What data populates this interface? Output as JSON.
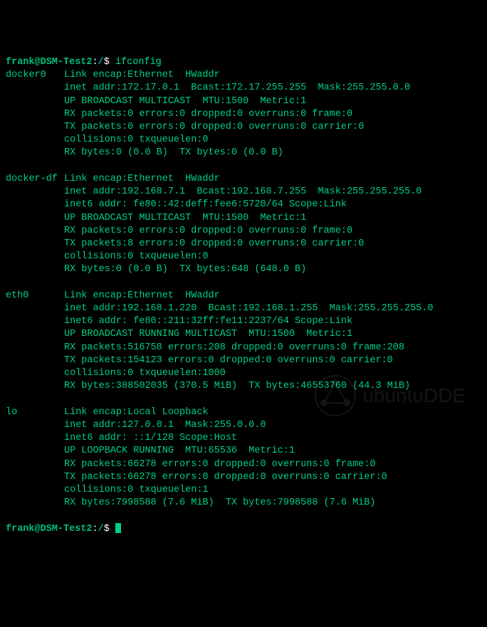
{
  "prompt": {
    "user": "frank@DSM-Test2",
    "path": "/",
    "symbol": "$"
  },
  "command": "ifconfig",
  "interfaces": [
    {
      "name": "docker0",
      "lines": [
        "Link encap:Ethernet  HWaddr ",
        "inet addr:172.17.0.1  Bcast:172.17.255.255  Mask:255.255.0.0",
        "UP BROADCAST MULTICAST  MTU:1500  Metric:1",
        "RX packets:0 errors:0 dropped:0 overruns:0 frame:0",
        "TX packets:0 errors:0 dropped:0 overruns:0 carrier:0",
        "collisions:0 txqueuelen:0",
        "RX bytes:0 (0.0 B)  TX bytes:0 (0.0 B)"
      ],
      "redact_first_line": true
    },
    {
      "name": "docker-df",
      "lines": [
        "Link encap:Ethernet  HWaddr ",
        "inet addr:192.168.7.1  Bcast:192.168.7.255  Mask:255.255.255.0",
        "inet6 addr: fe80::42:deff:fee6:5720/64 Scope:Link",
        "UP BROADCAST MULTICAST  MTU:1500  Metric:1",
        "RX packets:0 errors:0 dropped:0 overruns:0 frame:0",
        "TX packets:8 errors:0 dropped:0 overruns:0 carrier:0",
        "collisions:0 txqueuelen:0",
        "RX bytes:0 (0.0 B)  TX bytes:648 (648.0 B)"
      ],
      "redact_first_line": true
    },
    {
      "name": "eth0",
      "lines": [
        "Link encap:Ethernet  HWaddr ",
        "inet addr:192.168.1.220  Bcast:192.168.1.255  Mask:255.255.255.0",
        "inet6 addr: fe80::211:32ff:fe11:2237/64 Scope:Link",
        "UP BROADCAST RUNNING MULTICAST  MTU:1500  Metric:1",
        "RX packets:516758 errors:208 dropped:0 overruns:0 frame:208",
        "TX packets:154123 errors:0 dropped:0 overruns:0 carrier:0",
        "collisions:0 txqueuelen:1000",
        "RX bytes:388502035 (370.5 MiB)  TX bytes:46553760 (44.3 MiB)"
      ],
      "redact_first_line": true
    },
    {
      "name": "lo",
      "lines": [
        "Link encap:Local Loopback",
        "inet addr:127.0.0.1  Mask:255.0.0.0",
        "inet6 addr: ::1/128 Scope:Host",
        "UP LOOPBACK RUNNING  MTU:65536  Metric:1",
        "RX packets:66278 errors:0 dropped:0 overruns:0 frame:0",
        "TX packets:66278 errors:0 dropped:0 overruns:0 carrier:0",
        "collisions:0 txqueuelen:1",
        "RX bytes:7998588 (7.6 MiB)  TX bytes:7998588 (7.6 MiB)"
      ],
      "redact_first_line": false
    }
  ],
  "watermark": "ubuntuDDE"
}
